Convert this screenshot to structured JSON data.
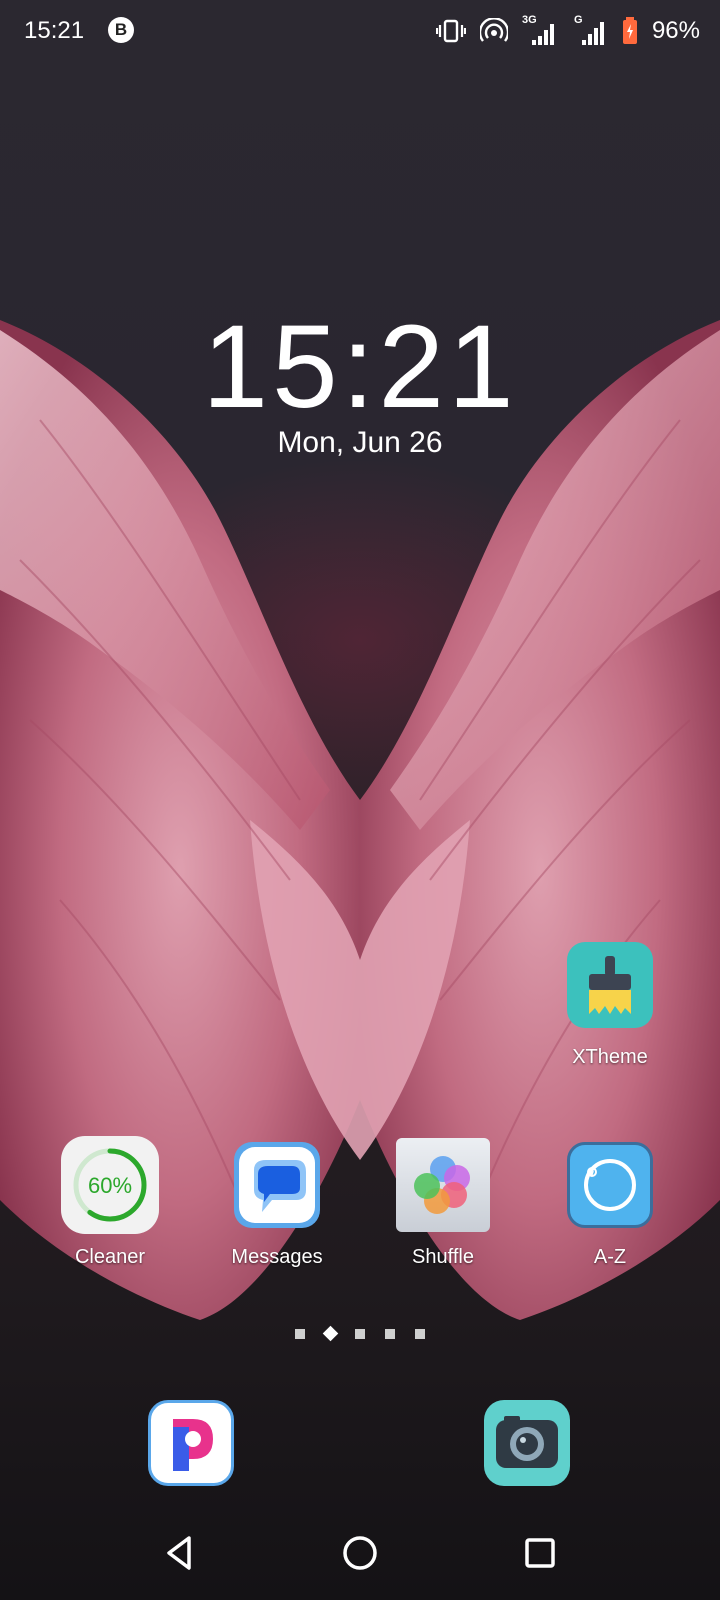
{
  "status_bar": {
    "time": "15:21",
    "notification_icon": "b-circle-icon",
    "icons": [
      "vibrate-icon",
      "hotspot-icon",
      "signal-3g-icon",
      "signal-g-icon",
      "battery-charging-icon"
    ],
    "network_3g": "3G",
    "network_g": "G",
    "battery_percent": "96%",
    "battery_level": 0.96
  },
  "clock_widget": {
    "time": "15:21",
    "date": "Mon, Jun 26"
  },
  "apps": {
    "xtheme": {
      "label": "XTheme",
      "icon": "brush-icon",
      "color": "#3cc1bd"
    },
    "cleaner": {
      "label": "Cleaner",
      "icon": "cleaner-ring-icon",
      "percent_text": "60%",
      "level": 0.6,
      "color": "#2ca82c"
    },
    "messages": {
      "label": "Messages",
      "icon": "chat-bubble-icon",
      "color": "#1a5fe0"
    },
    "shuffle": {
      "label": "Shuffle",
      "icon": "flower-petals-icon"
    },
    "az": {
      "label": "A-Z",
      "icon": "circle-arrow-icon",
      "color": "#4fb3ee"
    }
  },
  "page_indicator": {
    "count": 5,
    "active_index": 1
  },
  "dock": [
    {
      "name": "p-browser-icon",
      "color": "#ffffff"
    },
    {
      "name": "camera-icon",
      "color": "#5fd0cc"
    }
  ],
  "nav_bar": {
    "buttons": [
      "back-icon",
      "home-icon",
      "recents-icon"
    ]
  }
}
